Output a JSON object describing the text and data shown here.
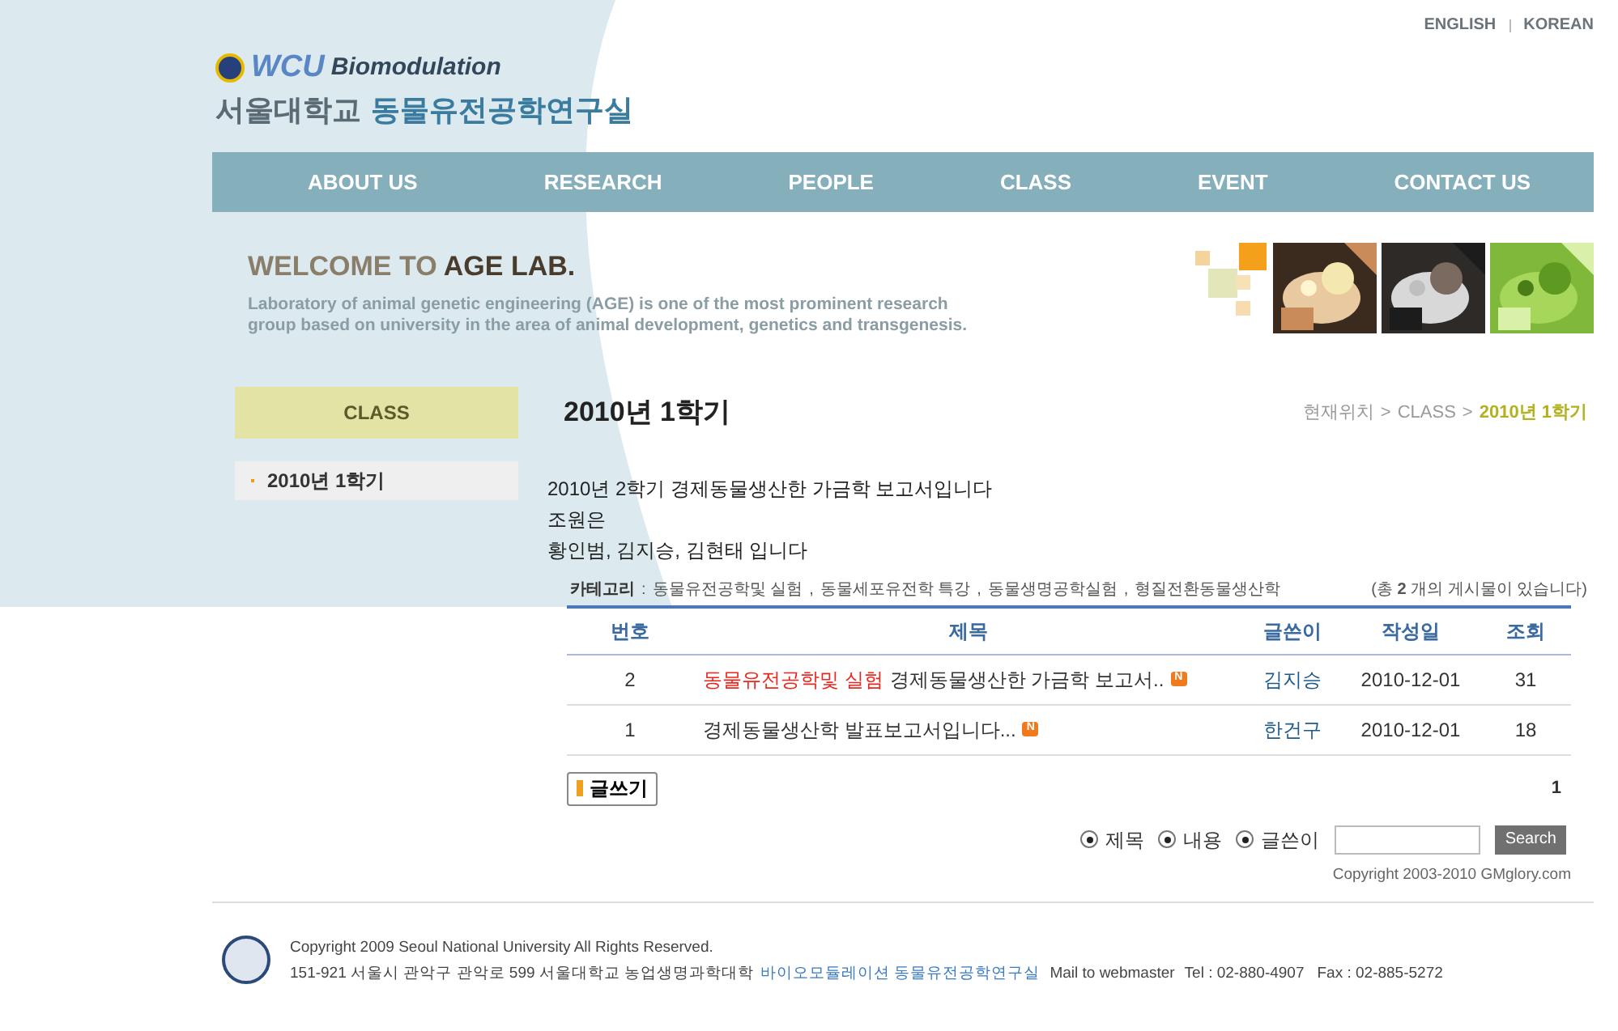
{
  "header": {
    "logo_brand": "WCU",
    "logo_subtitle": "Biomodulation",
    "lab_name_prefix": "서울대학교",
    "lab_name": "동물유전공학연구실",
    "languages": [
      {
        "label": "ENGLISH",
        "selected": false
      },
      {
        "label": "KOREAN",
        "selected": false
      }
    ]
  },
  "nav": [
    {
      "label": "ABOUT US"
    },
    {
      "label": "RESEARCH"
    },
    {
      "label": "PEOPLE"
    },
    {
      "label": "CLASS"
    },
    {
      "label": "EVENT"
    },
    {
      "label": "CONTACT US"
    }
  ],
  "welcome": {
    "title_prefix": "WELCOME TO",
    "title": "AGE LAB.",
    "description": "Laboratory of animal genetic engineering (AGE) is one of the most prominent research group based on university in the area of animal development, genetics and transgenesis."
  },
  "sidebar": {
    "title": "CLASS",
    "items": [
      {
        "label": "2010년 1학기",
        "selected": true
      }
    ]
  },
  "page": {
    "title": "2010년 1학기",
    "breadcrumb": [
      {
        "label": "현재위치"
      },
      {
        "label": "CLASS"
      },
      {
        "label": "2010년 1학기"
      }
    ],
    "breadcrumb_separator": ">",
    "intro": [
      "2010년 2학기 경제동물생산한 가금학 보고서입니다",
      "조원은",
      "황인범, 김지승, 김현태 입니다"
    ],
    "category_label": "카테고리",
    "category_colon": ":",
    "category_separator": ",",
    "categories": [
      "동물유전공학및 실험",
      "동물세포유전학 특강",
      "동물생명공학실험",
      "형질전환동물생산학"
    ],
    "count_text": "(총 **2** 개의 게시물이 있습니다)",
    "table": {
      "columns": [
        "번호",
        "제목",
        "글쓴이",
        "작성일",
        "조회"
      ],
      "rows": [
        {
          "number": "2",
          "category": "동물유전공학및 실험",
          "title": "경제동물생산한 가금학 보고서..",
          "new_badge": "N",
          "author": "김지승",
          "date": "2010-12-01",
          "views": "31"
        },
        {
          "number": "1",
          "title": "경제동물생산학 발표보고서입니다...",
          "new_badge": "N",
          "author": "한건구",
          "date": "2010-12-01",
          "views": "18"
        }
      ]
    },
    "write_button": "글쓰기",
    "pages": [
      "1"
    ],
    "search": {
      "options": [
        {
          "label": "제목",
          "checked": true
        },
        {
          "label": "내용",
          "checked": true
        },
        {
          "label": "글쓴이",
          "checked": true
        }
      ],
      "button": "Search"
    },
    "board_copyright": "Copyright 2003-2010 GMglory.com"
  },
  "footer": {
    "copyright": "Copyright 2009 Seoul National University All Rights Reserved.",
    "address": "151-921 서울시 관악구 관악로 599 서울대학교 농업생명과학대학",
    "lab_link": "바이오모듈레이션 동물유전공학연구실",
    "mail": "Mail to webmaster",
    "tel": "Tel : 02-880-4907",
    "fax": "Fax : 02-885-5272"
  }
}
